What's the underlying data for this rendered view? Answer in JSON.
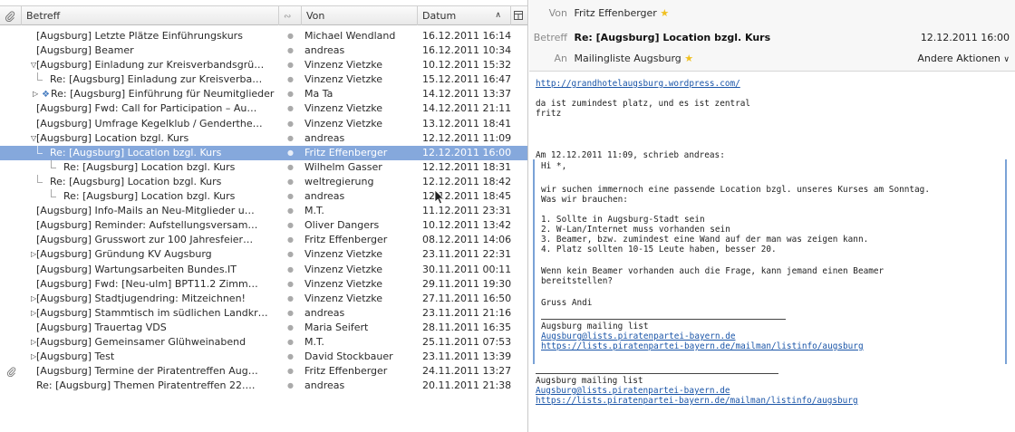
{
  "columns": {
    "subject": "Betreff",
    "from": "Von",
    "date": "Datum",
    "sort_direction": "ascending"
  },
  "messages": [
    {
      "subject": "[Augsburg] Letzte Plätze Einführungskurs",
      "from": "Michael Wendland",
      "date": "16.12.2011 16:14"
    },
    {
      "subject": "[Augsburg] Beamer",
      "from": "andreas",
      "date": "16.12.2011 10:34"
    },
    {
      "subject": "[Augsburg] Einladung zur Kreisverbandsgrü…",
      "from": "Vinzenz Vietzke",
      "date": "10.12.2011 15:32"
    },
    {
      "subject": "Re: [Augsburg] Einladung zur Kreisverba…",
      "from": "Vinzenz Vietzke",
      "date": "15.12.2011 16:47"
    },
    {
      "subject": "Re: [Augsburg] Einführung für Neumitglieder",
      "from": "Ma Ta",
      "date": "14.12.2011 13:37"
    },
    {
      "subject": "[Augsburg] Fwd: Call for Participation – Au…",
      "from": "Vinzenz Vietzke",
      "date": "14.12.2011 21:11"
    },
    {
      "subject": "[Augsburg] Umfrage Kegelklub / Genderthe…",
      "from": "Vinzenz Vietzke",
      "date": "13.12.2011 18:41"
    },
    {
      "subject": "[Augsburg] Location bzgl. Kurs",
      "from": "andreas",
      "date": "12.12.2011 11:09"
    },
    {
      "subject": "Re: [Augsburg] Location bzgl. Kurs",
      "from": "Fritz Effenberger",
      "date": "12.12.2011 16:00"
    },
    {
      "subject": "Re: [Augsburg] Location bzgl. Kurs",
      "from": "Wilhelm Gasser",
      "date": "12.12.2011 18:31"
    },
    {
      "subject": "Re: [Augsburg] Location bzgl. Kurs",
      "from": "weltregierung",
      "date": "12.12.2011 18:42"
    },
    {
      "subject": "Re: [Augsburg] Location bzgl. Kurs",
      "from": "andreas",
      "date": "12.12.2011 18:45"
    },
    {
      "subject": "[Augsburg] Info-Mails an Neu-Mitglieder u…",
      "from": "M.T.",
      "date": "11.12.2011 23:31"
    },
    {
      "subject": "[Augsburg] Reminder: Aufstellungsversam…",
      "from": "Oliver Dangers",
      "date": "10.12.2011 13:42"
    },
    {
      "subject": "[Augsburg] Grusswort zur 100 Jahresfeier…",
      "from": "Fritz Effenberger",
      "date": "08.12.2011 14:06"
    },
    {
      "subject": "[Augsburg] Gründung KV Augsburg",
      "from": "Vinzenz Vietzke",
      "date": "23.11.2011 22:31"
    },
    {
      "subject": "[Augsburg] Wartungsarbeiten Bundes.IT",
      "from": "Vinzenz Vietzke",
      "date": "30.11.2011 00:11"
    },
    {
      "subject": "[Augsburg] Fwd: [Neu-ulm] BPT11.2 Zimm…",
      "from": "Vinzenz Vietzke",
      "date": "29.11.2011 19:30"
    },
    {
      "subject": "[Augsburg] Stadtjugendring: Mitzeichnen!",
      "from": "Vinzenz Vietzke",
      "date": "27.11.2011 16:50"
    },
    {
      "subject": "[Augsburg] Stammtisch im südlichen Landkr…",
      "from": "andreas",
      "date": "23.11.2011 21:16"
    },
    {
      "subject": "[Augsburg] Trauertag VDS",
      "from": "Maria Seifert",
      "date": "28.11.2011 16:35"
    },
    {
      "subject": "[Augsburg] Gemeinsamer Glühweinabend",
      "from": "M.T.",
      "date": "25.11.2011 07:53"
    },
    {
      "subject": "[Augsburg] Test",
      "from": "David Stockbauer",
      "date": "23.11.2011 13:39"
    },
    {
      "subject": "[Augsburg] Termine der Piratentreffen Aug…",
      "from": "Fritz Effenberger",
      "date": "24.11.2011 13:27"
    },
    {
      "subject": "Re: [Augsburg] Themen Piratentreffen 22.…",
      "from": "andreas",
      "date": "20.11.2011 21:38"
    }
  ],
  "message_view": {
    "from_label": "Von",
    "from_value": "Fritz Effenberger",
    "subject_label": "Betreff",
    "subject_value": "Re: [Augsburg] Location bzgl. Kurs",
    "date_value": "12.12.2011 16:00",
    "to_label": "An",
    "to_value": "Mailingliste Augsburg",
    "more_actions": "Andere Aktionen"
  },
  "body": {
    "link1": "http://grandhotelaugsburg.wordpress.com/",
    "p1_l1": "da ist zumindest platz, und es ist zentral",
    "p1_l2": "fritz",
    "quote_intro": "Am 12.12.2011 11:09, schrieb andreas:",
    "q1": "Hi *,",
    "q2": "wir suchen immernoch eine passende Location bzgl. unseres Kurses am Sonntag.",
    "q3": "Was wir brauchen:",
    "q4": "1. Sollte in Augsburg-Stadt sein",
    "q5": "2. W-Lan/Internet muss vorhanden sein",
    "q6": "3. Beamer, bzw. zumindest eine Wand auf der man was zeigen kann.",
    "q7": "4. Platz sollten 10-15 Leute haben, besser 20.",
    "q8": "Wenn kein Beamer vorhanden auch die Frage, kann jemand einen Beamer",
    "q9": "bereitstellen?",
    "q10": "Gruss Andi",
    "q_list": "Augsburg mailing list",
    "q_mail": "Augsburg@lists.piratenpartei-bayern.de",
    "q_url": "https://lists.piratenpartei-bayern.de/mailman/listinfo/augsburg",
    "s_list": "Augsburg mailing list",
    "s_mail": "Augsburg@lists.piratenpartei-bayern.de",
    "s_url": "https://lists.piratenpartei-bayern.de/mailman/listinfo/augsburg"
  }
}
